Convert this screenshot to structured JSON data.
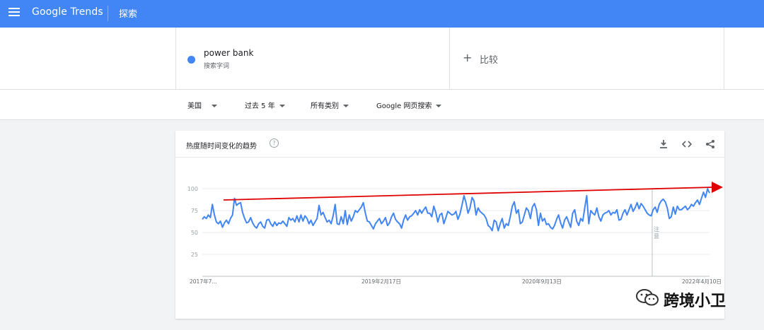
{
  "app": {
    "brand_google": "Google",
    "brand_trends": "Trends",
    "section_title": "探索"
  },
  "term": {
    "name": "power bank",
    "type": "搜索字词",
    "color": "#4285f4"
  },
  "compare": {
    "plus": "+",
    "label": "比较"
  },
  "filters": [
    {
      "label": "美国"
    },
    {
      "label": "过去 5 年"
    },
    {
      "label": "所有类别"
    },
    {
      "label": "Google 网页搜索"
    }
  ],
  "card": {
    "title": "热度随时间变化的趋势",
    "help": "?",
    "actions": [
      "download-icon",
      "embed-icon",
      "share-icon"
    ]
  },
  "chart_data": {
    "type": "line",
    "ylim": [
      0,
      100
    ],
    "yticks": [
      100,
      75,
      50,
      25
    ],
    "xtick_labels": [
      "2017年7...",
      "2019年2月17日",
      "2020年9月13日",
      "2022年4月10日"
    ],
    "annotation": "注意",
    "series": [
      {
        "color": "#4285f4",
        "values": [
          65,
          68,
          66,
          70,
          67,
          82,
          70,
          62,
          60,
          63,
          56,
          61,
          64,
          60,
          66,
          70,
          89,
          81,
          83,
          84,
          73,
          66,
          61,
          62,
          67,
          61,
          57,
          55,
          60,
          62,
          57,
          55,
          64,
          65,
          60,
          57,
          62,
          58,
          61,
          60,
          63,
          60,
          57,
          67,
          64,
          66,
          62,
          69,
          62,
          70,
          63,
          69,
          66,
          60,
          64,
          58,
          62,
          66,
          81,
          70,
          73,
          67,
          62,
          64,
          60,
          69,
          82,
          60,
          59,
          68,
          60,
          75,
          59,
          70,
          63,
          68,
          75,
          73,
          76,
          79,
          84,
          72,
          63,
          62,
          58,
          54,
          60,
          63,
          66,
          60,
          63,
          67,
          58,
          61,
          68,
          72,
          65,
          62,
          60,
          55,
          64,
          70,
          64,
          68,
          69,
          72,
          75,
          70,
          76,
          72,
          76,
          79,
          72,
          72,
          68,
          80,
          73,
          62,
          70,
          72,
          60,
          67,
          74,
          72,
          70,
          71,
          74,
          65,
          71,
          81,
          92,
          84,
          72,
          78,
          90,
          86,
          70,
          78,
          74,
          72,
          70,
          66,
          58,
          56,
          52,
          64,
          62,
          52,
          60,
          66,
          55,
          60,
          58,
          68,
          80,
          85,
          72,
          76,
          60,
          62,
          70,
          78,
          75,
          66,
          79,
          83,
          76,
          58,
          72,
          63,
          66,
          59,
          60,
          56,
          54,
          58,
          65,
          70,
          61,
          55,
          64,
          68,
          62,
          56,
          72,
          76,
          63,
          58,
          66,
          63,
          78,
          92,
          60,
          75,
          72,
          70,
          78,
          68,
          63,
          70,
          72,
          73,
          75,
          70,
          73,
          72,
          76,
          64,
          65,
          72,
          76,
          70,
          76,
          82,
          74,
          78,
          84,
          77,
          83,
          80,
          76,
          72,
          70,
          69,
          76,
          79,
          73,
          82,
          86,
          88,
          85,
          78,
          66,
          68,
          79,
          71,
          80,
          76,
          76,
          78,
          80,
          76,
          78,
          82,
          80,
          84,
          87,
          82,
          89,
          96,
          90,
          102,
          95
        ]
      }
    ],
    "trend_arrow_color": "#e00000"
  },
  "watermark": {
    "text": "跨境小卫"
  }
}
